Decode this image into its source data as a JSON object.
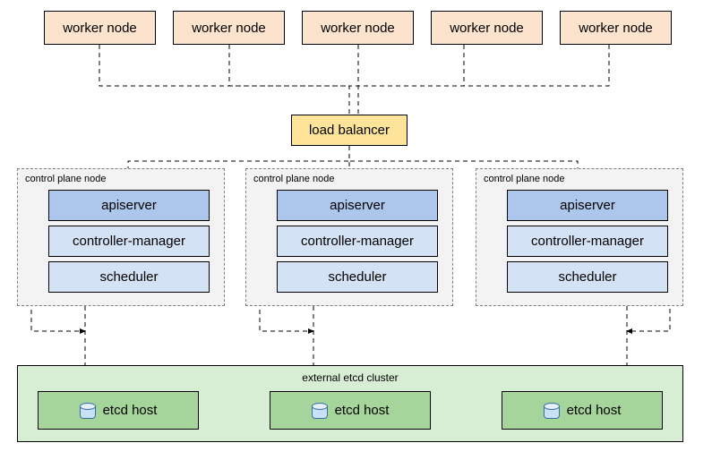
{
  "workers": [
    {
      "label": "worker node"
    },
    {
      "label": "worker node"
    },
    {
      "label": "worker node"
    },
    {
      "label": "worker node"
    },
    {
      "label": "worker node"
    }
  ],
  "load_balancer": {
    "label": "load balancer"
  },
  "control_planes": [
    {
      "title": "control plane node",
      "apiserver": "apiserver",
      "controller_manager": "controller-manager",
      "scheduler": "scheduler"
    },
    {
      "title": "control plane node",
      "apiserver": "apiserver",
      "controller_manager": "controller-manager",
      "scheduler": "scheduler"
    },
    {
      "title": "control plane node",
      "apiserver": "apiserver",
      "controller_manager": "controller-manager",
      "scheduler": "scheduler"
    }
  ],
  "etcd": {
    "cluster_label": "external etcd cluster",
    "hosts": [
      {
        "label": "etcd host"
      },
      {
        "label": "etcd host"
      },
      {
        "label": "etcd host"
      }
    ]
  }
}
